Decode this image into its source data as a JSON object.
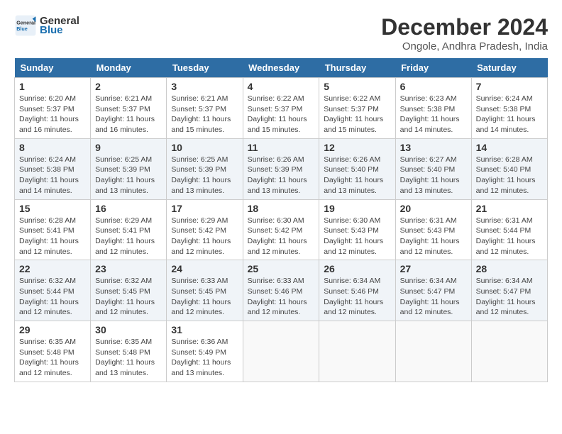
{
  "header": {
    "logo_general": "General",
    "logo_blue": "Blue",
    "month_title": "December 2024",
    "location": "Ongole, Andhra Pradesh, India"
  },
  "days_of_week": [
    "Sunday",
    "Monday",
    "Tuesday",
    "Wednesday",
    "Thursday",
    "Friday",
    "Saturday"
  ],
  "weeks": [
    [
      {
        "day": "1",
        "sunrise": "6:20 AM",
        "sunset": "5:37 PM",
        "daylight": "11 hours and 16 minutes."
      },
      {
        "day": "2",
        "sunrise": "6:21 AM",
        "sunset": "5:37 PM",
        "daylight": "11 hours and 16 minutes."
      },
      {
        "day": "3",
        "sunrise": "6:21 AM",
        "sunset": "5:37 PM",
        "daylight": "11 hours and 15 minutes."
      },
      {
        "day": "4",
        "sunrise": "6:22 AM",
        "sunset": "5:37 PM",
        "daylight": "11 hours and 15 minutes."
      },
      {
        "day": "5",
        "sunrise": "6:22 AM",
        "sunset": "5:37 PM",
        "daylight": "11 hours and 15 minutes."
      },
      {
        "day": "6",
        "sunrise": "6:23 AM",
        "sunset": "5:38 PM",
        "daylight": "11 hours and 14 minutes."
      },
      {
        "day": "7",
        "sunrise": "6:24 AM",
        "sunset": "5:38 PM",
        "daylight": "11 hours and 14 minutes."
      }
    ],
    [
      {
        "day": "8",
        "sunrise": "6:24 AM",
        "sunset": "5:38 PM",
        "daylight": "11 hours and 14 minutes."
      },
      {
        "day": "9",
        "sunrise": "6:25 AM",
        "sunset": "5:39 PM",
        "daylight": "11 hours and 13 minutes."
      },
      {
        "day": "10",
        "sunrise": "6:25 AM",
        "sunset": "5:39 PM",
        "daylight": "11 hours and 13 minutes."
      },
      {
        "day": "11",
        "sunrise": "6:26 AM",
        "sunset": "5:39 PM",
        "daylight": "11 hours and 13 minutes."
      },
      {
        "day": "12",
        "sunrise": "6:26 AM",
        "sunset": "5:40 PM",
        "daylight": "11 hours and 13 minutes."
      },
      {
        "day": "13",
        "sunrise": "6:27 AM",
        "sunset": "5:40 PM",
        "daylight": "11 hours and 13 minutes."
      },
      {
        "day": "14",
        "sunrise": "6:28 AM",
        "sunset": "5:40 PM",
        "daylight": "11 hours and 12 minutes."
      }
    ],
    [
      {
        "day": "15",
        "sunrise": "6:28 AM",
        "sunset": "5:41 PM",
        "daylight": "11 hours and 12 minutes."
      },
      {
        "day": "16",
        "sunrise": "6:29 AM",
        "sunset": "5:41 PM",
        "daylight": "11 hours and 12 minutes."
      },
      {
        "day": "17",
        "sunrise": "6:29 AM",
        "sunset": "5:42 PM",
        "daylight": "11 hours and 12 minutes."
      },
      {
        "day": "18",
        "sunrise": "6:30 AM",
        "sunset": "5:42 PM",
        "daylight": "11 hours and 12 minutes."
      },
      {
        "day": "19",
        "sunrise": "6:30 AM",
        "sunset": "5:43 PM",
        "daylight": "11 hours and 12 minutes."
      },
      {
        "day": "20",
        "sunrise": "6:31 AM",
        "sunset": "5:43 PM",
        "daylight": "11 hours and 12 minutes."
      },
      {
        "day": "21",
        "sunrise": "6:31 AM",
        "sunset": "5:44 PM",
        "daylight": "11 hours and 12 minutes."
      }
    ],
    [
      {
        "day": "22",
        "sunrise": "6:32 AM",
        "sunset": "5:44 PM",
        "daylight": "11 hours and 12 minutes."
      },
      {
        "day": "23",
        "sunrise": "6:32 AM",
        "sunset": "5:45 PM",
        "daylight": "11 hours and 12 minutes."
      },
      {
        "day": "24",
        "sunrise": "6:33 AM",
        "sunset": "5:45 PM",
        "daylight": "11 hours and 12 minutes."
      },
      {
        "day": "25",
        "sunrise": "6:33 AM",
        "sunset": "5:46 PM",
        "daylight": "11 hours and 12 minutes."
      },
      {
        "day": "26",
        "sunrise": "6:34 AM",
        "sunset": "5:46 PM",
        "daylight": "11 hours and 12 minutes."
      },
      {
        "day": "27",
        "sunrise": "6:34 AM",
        "sunset": "5:47 PM",
        "daylight": "11 hours and 12 minutes."
      },
      {
        "day": "28",
        "sunrise": "6:34 AM",
        "sunset": "5:47 PM",
        "daylight": "11 hours and 12 minutes."
      }
    ],
    [
      {
        "day": "29",
        "sunrise": "6:35 AM",
        "sunset": "5:48 PM",
        "daylight": "11 hours and 12 minutes."
      },
      {
        "day": "30",
        "sunrise": "6:35 AM",
        "sunset": "5:48 PM",
        "daylight": "11 hours and 13 minutes."
      },
      {
        "day": "31",
        "sunrise": "6:36 AM",
        "sunset": "5:49 PM",
        "daylight": "11 hours and 13 minutes."
      },
      null,
      null,
      null,
      null
    ]
  ],
  "labels": {
    "sunrise": "Sunrise:",
    "sunset": "Sunset:",
    "daylight": "Daylight:"
  }
}
